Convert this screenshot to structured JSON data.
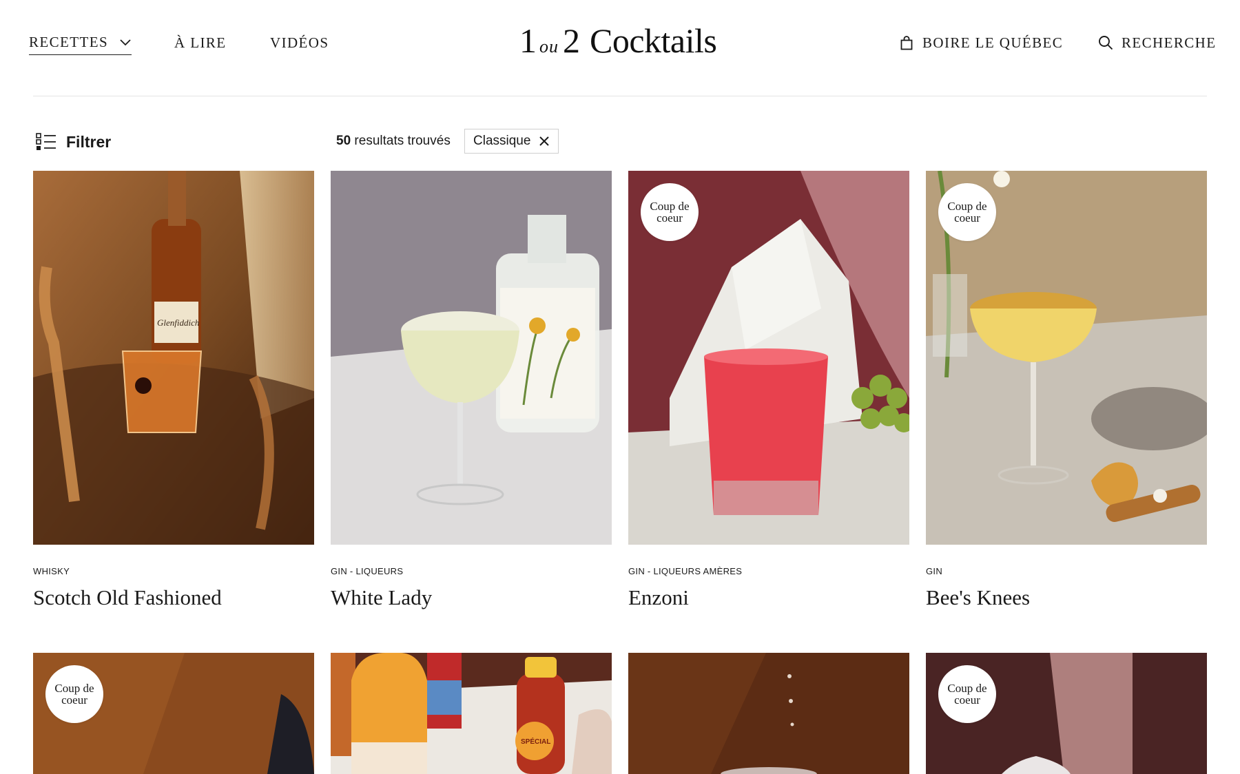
{
  "nav": {
    "recettes": "RECETTES",
    "lire": "À LIRE",
    "videos": "VIDÉOS",
    "boire": "BOIRE LE QUÉBEC",
    "search": "RECHERCHE"
  },
  "logo": {
    "one": "1",
    "ou": "ou",
    "two": "2",
    "word": "Cocktails"
  },
  "filter": {
    "label": "Filtrer",
    "results_count": "50",
    "results_text": "resultats trouvés",
    "chip_label": "Classique"
  },
  "badge_text": "Coup de coeur",
  "cards": [
    {
      "category": "WHISKY",
      "title": "Scotch Old Fashioned",
      "badge": false
    },
    {
      "category": "GIN - LIQUEURS",
      "title": "White Lady",
      "badge": false
    },
    {
      "category": "GIN - LIQUEURS AMÈRES",
      "title": "Enzoni",
      "badge": true
    },
    {
      "category": "GIN",
      "title": "Bee's Knees",
      "badge": true
    },
    {
      "badge": true
    },
    {
      "badge": false
    },
    {
      "badge": false
    },
    {
      "badge": true
    }
  ],
  "photo_labels": {
    "glenfiddich": "Glenfiddich",
    "special": "SPÉCIAL"
  },
  "colors": {
    "text": "#1a1a1a",
    "rule": "#e4e4e4",
    "chip_border": "#cfcfcf"
  }
}
